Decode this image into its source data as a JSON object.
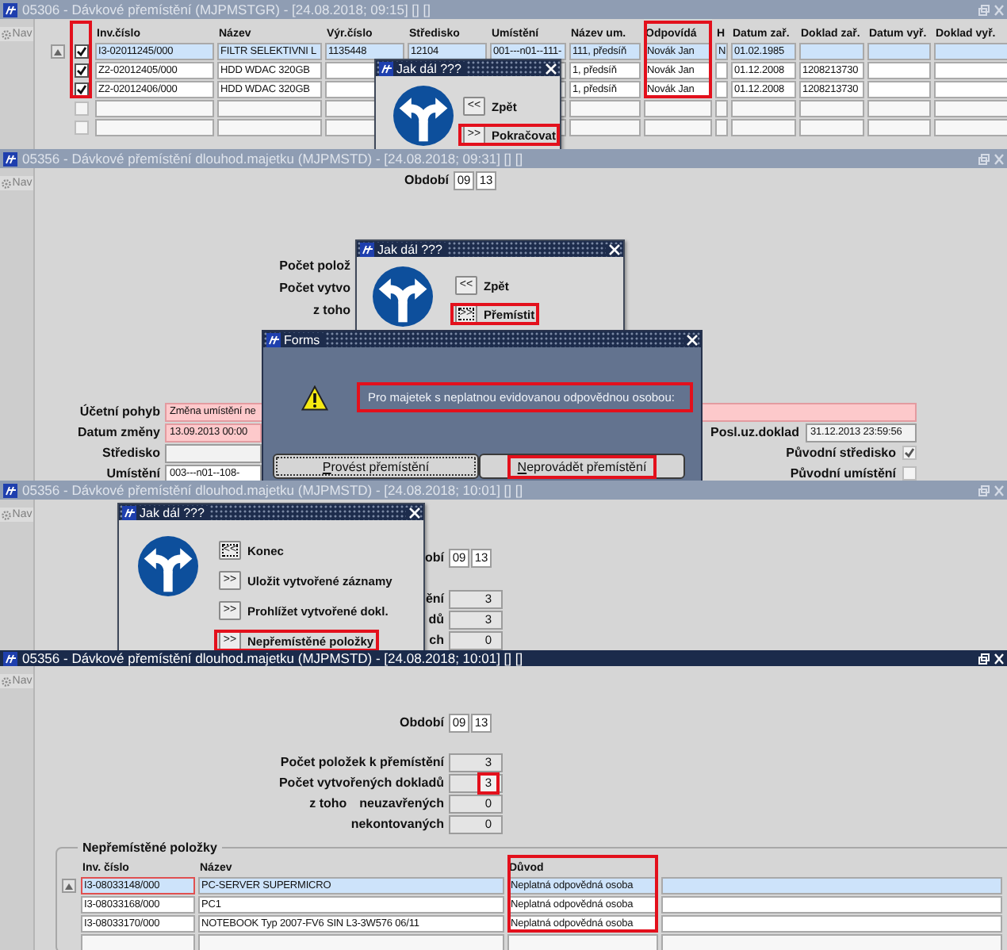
{
  "first_window": {
    "title": "05306 - Dávkové přemístění (MJPMSTGR) - [24.08.2018; 09:15] [] []",
    "active": false,
    "nav": "Nav",
    "checkbox_column_highlighted": true,
    "columns": [
      {
        "label": "Inv.číslo",
        "highlighted": false
      },
      {
        "label": "Název",
        "highlighted": false
      },
      {
        "label": "Výr.číslo",
        "highlighted": false
      },
      {
        "label": "Středisko",
        "highlighted": false
      },
      {
        "label": "Umístění",
        "highlighted": false
      },
      {
        "label": "Název um.",
        "highlighted": false
      },
      {
        "label": "Odpovídá",
        "highlighted": true
      },
      {
        "label": "H",
        "highlighted": false
      },
      {
        "label": "Datum zař.",
        "highlighted": false
      },
      {
        "label": "Doklad zař.",
        "highlighted": false
      },
      {
        "label": "Datum vyř.",
        "highlighted": false
      },
      {
        "label": "Doklad vyř.",
        "highlighted": false
      }
    ],
    "rows": [
      {
        "selected": true,
        "checked": true,
        "disabled": false,
        "cells": [
          "I3-02011245/000",
          "FILTR SELEKTIVNI L",
          "1135448",
          "12104",
          "001---n01--111-",
          "111, předsíň",
          "Novák Jan",
          "N",
          "01.02.1985",
          null,
          null,
          null
        ]
      },
      {
        "selected": false,
        "checked": true,
        "disabled": false,
        "cells": [
          "Z2-02012405/000",
          "HDD WDAC 320GB",
          null,
          null,
          null,
          "1, předsíň",
          "Novák Jan",
          null,
          "01.12.2008",
          "1208213730",
          null,
          null
        ]
      },
      {
        "selected": false,
        "checked": true,
        "disabled": false,
        "cells": [
          "Z2-02012406/000",
          "HDD WDAC 320GB",
          null,
          null,
          null,
          "1, předsíň",
          "Novák Jan",
          null,
          "01.12.2008",
          "1208213730",
          null,
          null
        ]
      }
    ],
    "blank_rows": [
      {
        "checked": false,
        "disabled": true
      },
      {
        "checked": false,
        "disabled": true
      }
    ],
    "dialog": {
      "title": "Jak dál ???",
      "actions": [
        {
          "key": "<<",
          "label": "Zpět",
          "highlighted": false,
          "focused": false
        },
        {
          "key": ">>",
          "label": "Pokračovat",
          "highlighted": true,
          "focused": false
        }
      ]
    }
  },
  "second_window": {
    "title": "05356 - Dávkové přemístění dlouhod.majetku (MJPMSTD) - [24.08.2018; 09:31] [] []",
    "active": false,
    "nav": "Nav",
    "period": {
      "label": "Období",
      "month": "09",
      "year": "13"
    },
    "count_labels": [
      "Počet polož",
      "Počet vytvo",
      "z toho"
    ],
    "fields": [
      {
        "label": "Účetní pohyb",
        "value": "Změna umístění ne",
        "required": true
      },
      {
        "label": "Datum změny",
        "value": "13.09.2013 00:00",
        "required": true
      },
      {
        "label": "Středisko",
        "required": false
      },
      {
        "label": "Umístění",
        "value": "003---n01--108-",
        "required": false
      }
    ],
    "side_items": [
      {
        "kind": "field",
        "label": "Posl.uz.doklad",
        "value": "31.12.2013 23:59:56"
      },
      {
        "kind": "checkbox",
        "label": "Původní středisko",
        "checked": true
      },
      {
        "kind": "checkbox",
        "label": "Původní umístění",
        "checked": false
      }
    ],
    "dialog": {
      "title": "Jak dál ???",
      "actions": [
        {
          "key": "<<",
          "label": "Zpět",
          "highlighted": false,
          "focused": false
        },
        {
          "key": ">>",
          "label": "Přemístit",
          "highlighted": true,
          "focused": true
        }
      ]
    },
    "alert": {
      "title": "Forms",
      "message": "Pro majetek s neplatnou evidovanou odpovědnou osobou:",
      "message_highlighted": true,
      "buttons": [
        {
          "label": "Provést přemístění",
          "highlighted": false,
          "focused": true
        },
        {
          "label": "Neprovádět přemístění",
          "highlighted": true,
          "focused": false
        }
      ]
    }
  },
  "third_window": {
    "title": "05356 - Dávkové přemístění dlouhod.majetku (MJPMSTD) - [24.08.2018; 10:01] [] []",
    "active": false,
    "nav": "Nav",
    "period": {
      "label": "obí",
      "month": "09",
      "year": "13"
    },
    "counts": [
      {
        "label": "ění",
        "value": "3",
        "highlighted": false
      },
      {
        "label": "dů",
        "value": "3",
        "highlighted": false
      },
      {
        "label": "ch",
        "value": "0",
        "highlighted": false
      }
    ],
    "dialog": {
      "title": "Jak dál ???",
      "actions": [
        {
          "key": "<<",
          "label": "Konec",
          "highlighted": false,
          "focused": true
        },
        {
          "key": ">>",
          "label": "Uložit vytvořené záznamy",
          "highlighted": false,
          "focused": false
        },
        {
          "key": ">>",
          "label": "Prohlížet vytvořené dokl.",
          "highlighted": false,
          "focused": false
        },
        {
          "key": ">>",
          "label": "Nepřemístěné položky",
          "highlighted": true,
          "focused": false
        }
      ]
    }
  },
  "fourth_window": {
    "title": "05356 - Dávkové přemístění dlouhod.majetku (MJPMSTD) - [24.08.2018; 10:01] [] []",
    "active": true,
    "nav": "Nav",
    "period": {
      "label": "Období",
      "month": "09",
      "year": "13"
    },
    "counts": [
      {
        "label": "Počet položek k přemístění",
        "value": "3",
        "highlighted": false
      },
      {
        "label": "Počet vytvořených dokladů",
        "value": "3",
        "highlighted": true
      },
      {
        "prefix": "z toho",
        "label": "neuzavřených",
        "value": "0",
        "highlighted": false
      },
      {
        "label": "nekontovaných",
        "value": "0",
        "highlighted": false
      }
    ],
    "group": {
      "title": "Nepřemístěné položky",
      "columns": [
        {
          "label": "Inv. číslo",
          "highlighted": false
        },
        {
          "label": "Název",
          "highlighted": false
        },
        {
          "label": "Důvod",
          "highlighted": true
        }
      ],
      "rows": [
        {
          "selected": true,
          "cells": [
            "I3-08033148/000",
            "PC-SERVER SUPERMICRO",
            "Neplatná odpovědná osoba"
          ]
        },
        {
          "selected": false,
          "cells": [
            "I3-08033168/000",
            "PC1",
            "Neplatná odpovědná osoba"
          ]
        },
        {
          "selected": false,
          "cells": [
            "I3-08033170/000",
            "NOTEBOOK Typ 2007-FV6 SIN L3-3W576 06/11",
            "Neplatná odpovědná osoba"
          ]
        }
      ]
    }
  }
}
